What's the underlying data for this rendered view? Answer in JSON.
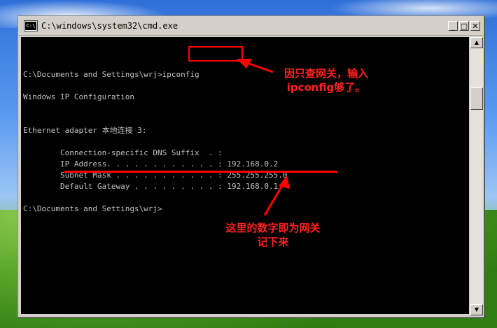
{
  "window": {
    "title": "C:\\windows\\system32\\cmd.exe",
    "icon": "cmd-icon",
    "controls": {
      "minimize": "_",
      "maximize": "□",
      "close": "✕"
    }
  },
  "console": {
    "lines": [
      "C:\\Documents and Settings\\wrj>ipconfig",
      "Windows IP Configuration",
      "Ethernet adapter 本地连接 3:",
      "        Connection-specific DNS Suffix  . :",
      "        IP Address. . . . . . . . . . . . : 192.168.0.2",
      "        Subnet Mask . . . . . . . . . . . : 255.255.255.0",
      "        Default Gateway . . . . . . . . . : 192.168.0.1",
      "C:\\Documents and Settings\\wrj>"
    ]
  },
  "annotations": {
    "top_line1": "因只查网关，输入",
    "top_line2": "ipconfig够了。",
    "bottom_line1": "这里的数字即为网关",
    "bottom_line2": "记下来",
    "color": "#ff0000"
  },
  "scrollbar": {
    "up": "▲",
    "down": "▼"
  }
}
